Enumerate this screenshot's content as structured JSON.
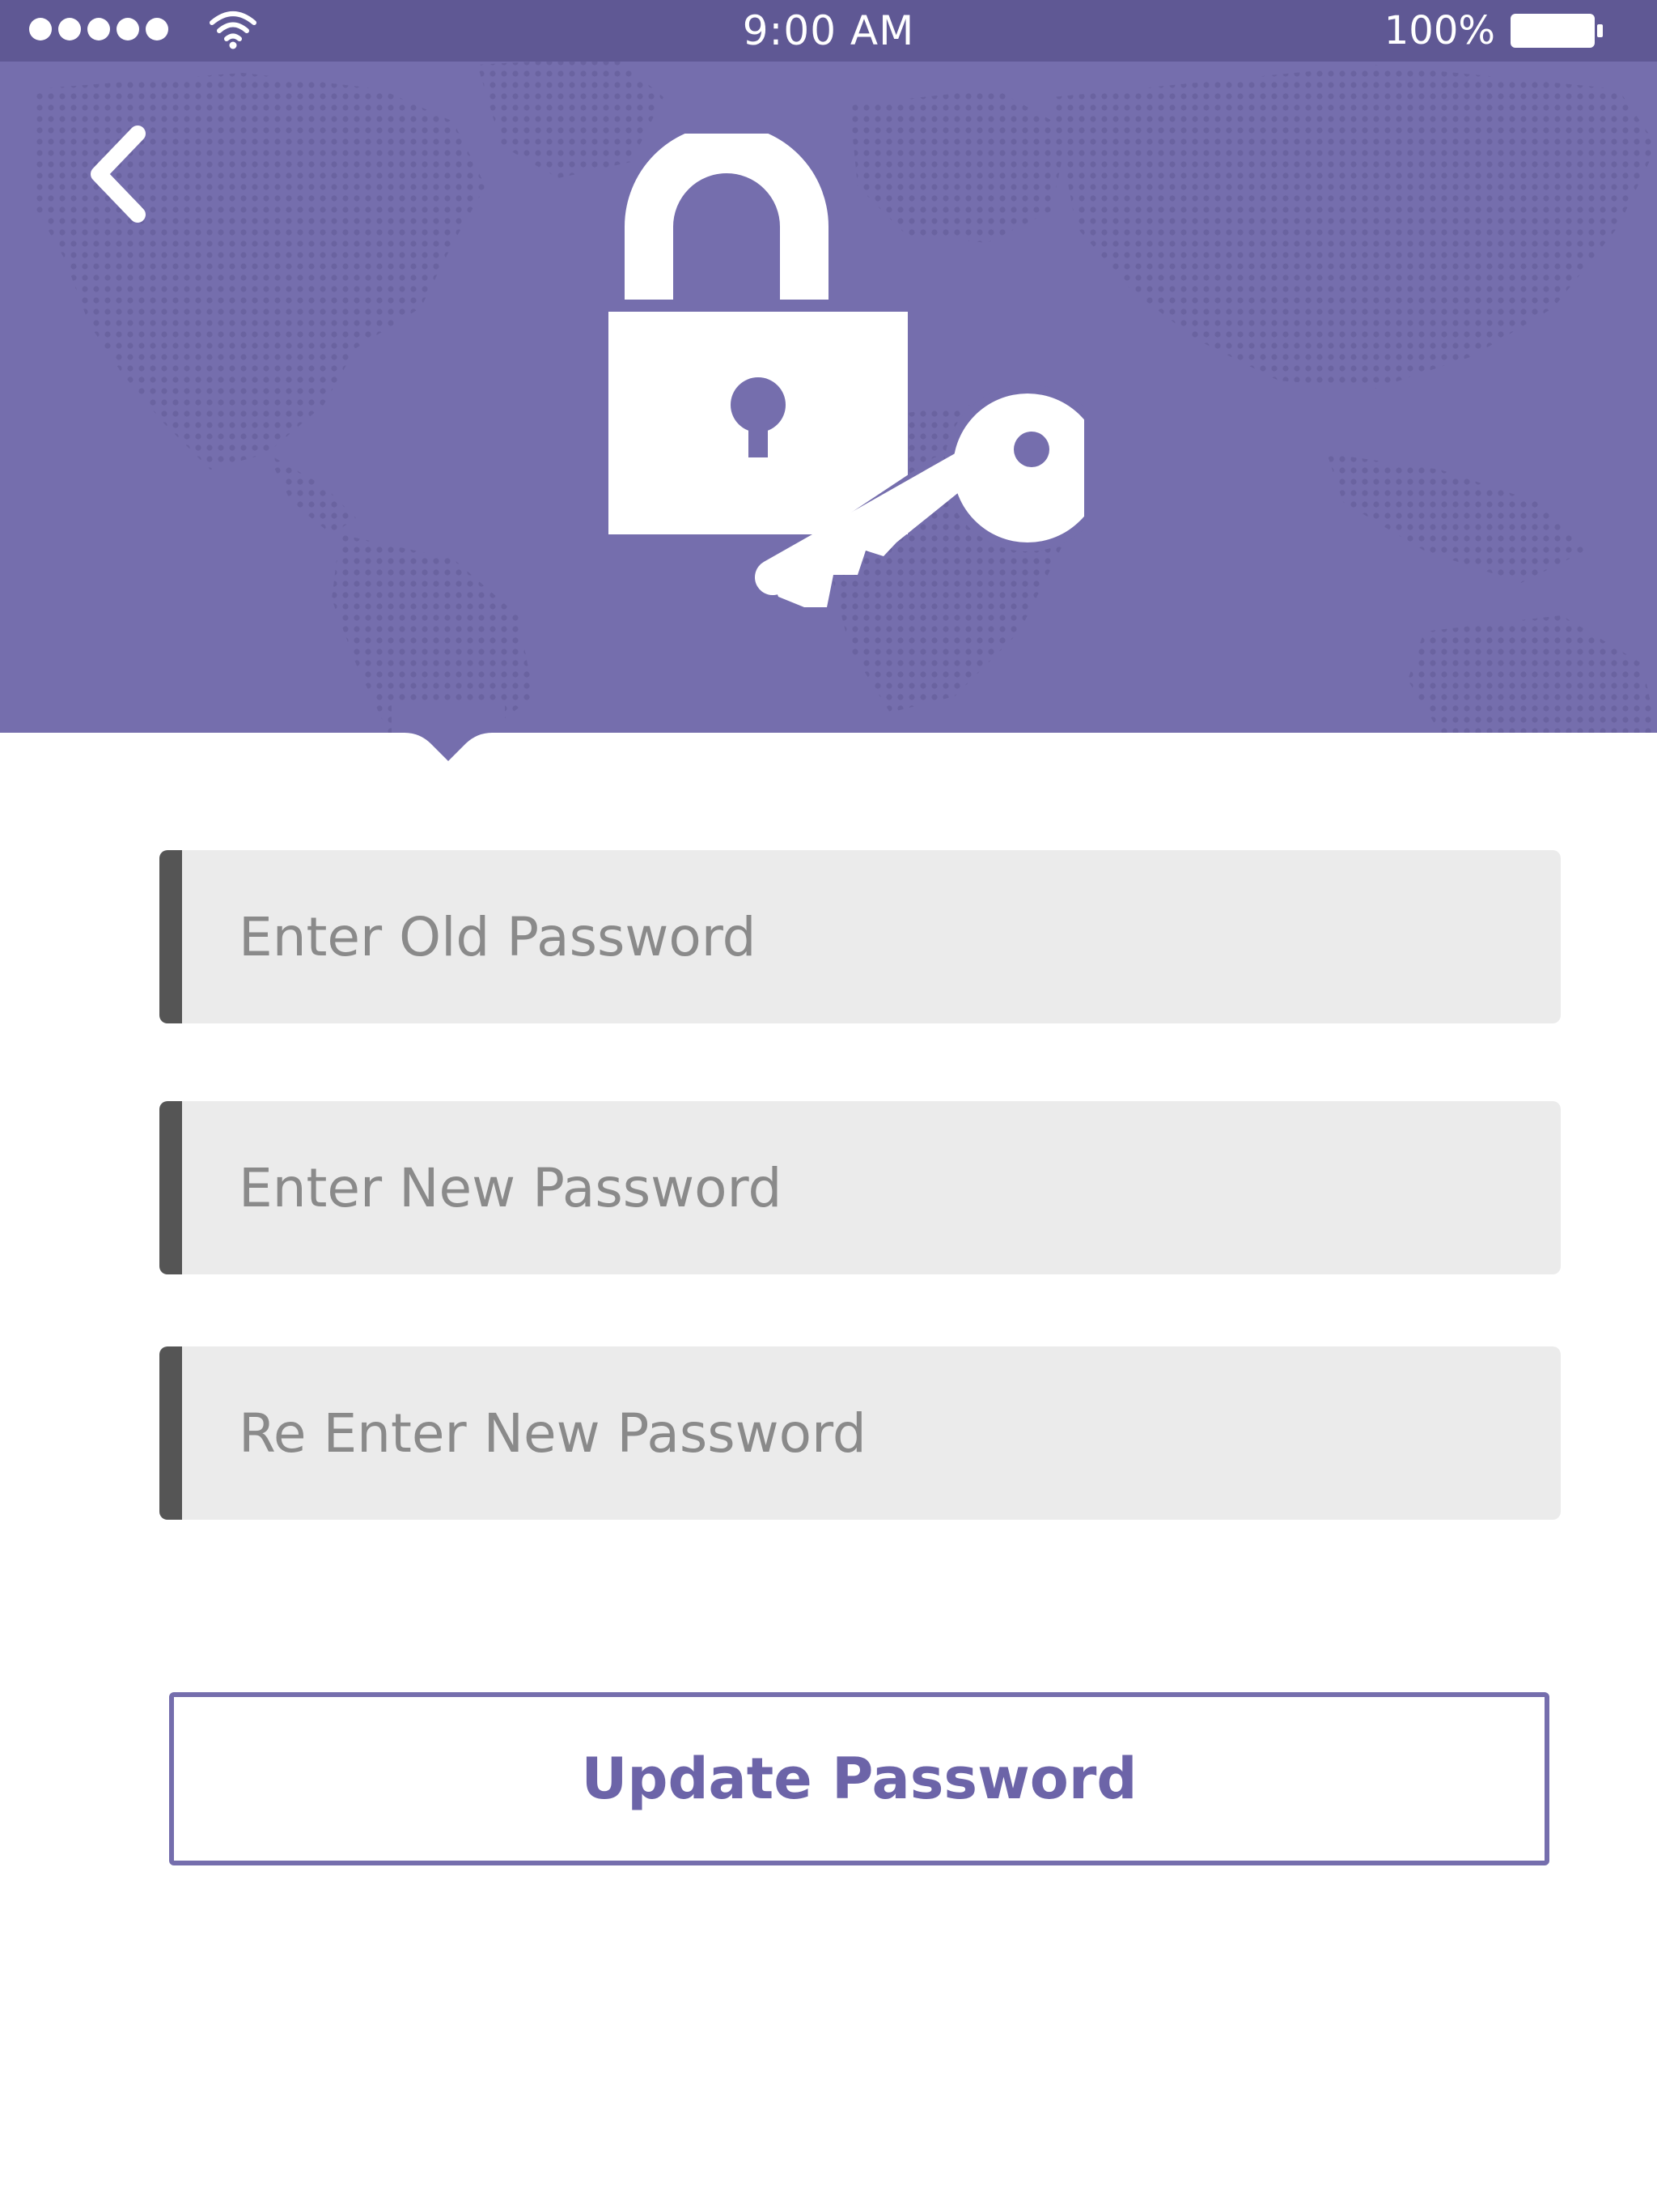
{
  "status_bar": {
    "time": "9:00 AM",
    "battery_percent": "100%",
    "signal_icon": "signal-dots-icon",
    "wifi_icon": "wifi-icon",
    "battery_icon": "battery-icon"
  },
  "header": {
    "back_icon": "chevron-left-icon",
    "hero_icon": "lock-key-icon",
    "background_pattern": "world-map-dots"
  },
  "form": {
    "old_password": {
      "placeholder": "Enter Old Password",
      "value": ""
    },
    "new_password": {
      "placeholder": "Enter New Password",
      "value": ""
    },
    "confirm_password": {
      "placeholder": "Re Enter New Password",
      "value": ""
    },
    "submit_label": "Update Password"
  },
  "colors": {
    "accent": "#756ead",
    "status_bar": "#5f5894",
    "field_background": "#ebebeb",
    "field_border": "#555555",
    "placeholder_text": "#8a8a8a",
    "button_text": "#6c64a8"
  }
}
